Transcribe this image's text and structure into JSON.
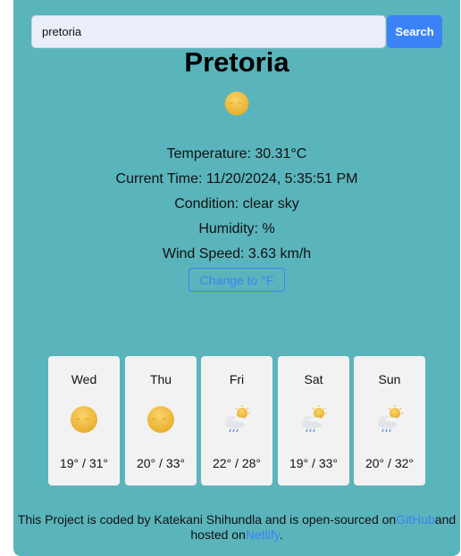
{
  "search": {
    "value": "pretoria",
    "button_label": "Search"
  },
  "weather": {
    "city": "Pretoria",
    "icon": "sun-icon",
    "temperature": "Temperature: 30.31°C",
    "current_time": "Current Time: 11/20/2024, 5:35:51 PM",
    "condition": "Condition: clear sky",
    "humidity": "Humidity: %",
    "wind_speed": "Wind Speed: 3.63 km/h",
    "unit_toggle_label": "Change to °F"
  },
  "forecast": [
    {
      "day": "Wed",
      "icon": "sun-icon",
      "temps": "19° / 31°"
    },
    {
      "day": "Thu",
      "icon": "sun-icon",
      "temps": "20° / 33°"
    },
    {
      "day": "Fri",
      "icon": "sun-cloud-rain-icon",
      "temps": "22° / 28°"
    },
    {
      "day": "Sat",
      "icon": "sun-cloud-rain-icon",
      "temps": "19° / 33°"
    },
    {
      "day": "Sun",
      "icon": "sun-cloud-rain-icon",
      "temps": "20° / 32°"
    }
  ],
  "footer": {
    "text_before": "This Project is coded by Katekani Shihundla and is open-sourced on",
    "github_label": "GitHub",
    "text_middle": "and hosted on",
    "netlify_label": "Netlify",
    "text_after": "."
  },
  "colors": {
    "app_background": "#5ab4bb",
    "accent": "#3b82f6",
    "card_background": "#f2f2f2"
  }
}
